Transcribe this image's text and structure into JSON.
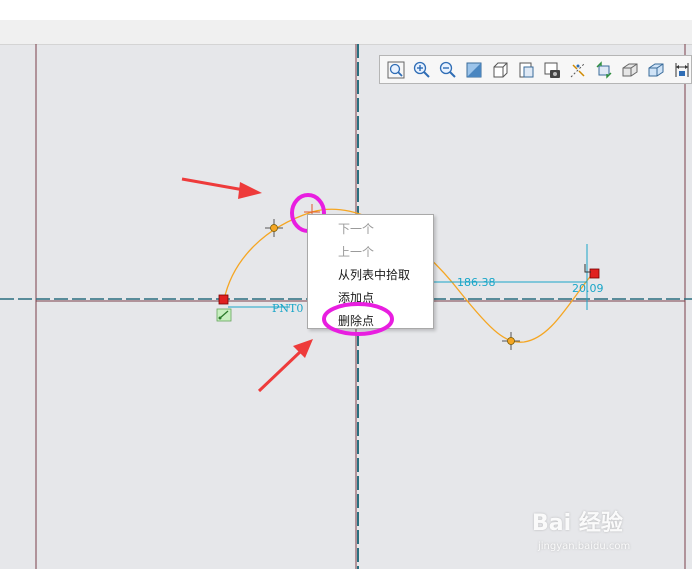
{
  "toolbar": {
    "buttons": [
      {
        "icon": "zoom-fit-icon"
      },
      {
        "icon": "zoom-in-icon"
      },
      {
        "icon": "zoom-out-icon"
      },
      {
        "icon": "shade-mode-icon"
      },
      {
        "icon": "view-orientation-icon"
      },
      {
        "icon": "view-manager-icon"
      },
      {
        "icon": "snapshot-icon"
      },
      {
        "icon": "datum-display-icon"
      },
      {
        "icon": "spin-center-icon"
      },
      {
        "icon": "display-style-icon"
      },
      {
        "icon": "saved-views-icon"
      },
      {
        "icon": "annotation-display-icon"
      }
    ]
  },
  "context_menu": {
    "items": [
      {
        "label": "下一个",
        "enabled": false
      },
      {
        "label": "上一个",
        "enabled": false
      },
      {
        "label": "从列表中拾取",
        "enabled": true
      },
      {
        "label": "添加点",
        "enabled": true
      },
      {
        "label": "删除点",
        "enabled": true
      }
    ]
  },
  "sketch": {
    "dimension_1": "186.38",
    "dimension_2": "20.09",
    "point_label": "PNT0"
  },
  "watermark": {
    "brand": "Bai 经验",
    "url": "jingyan.baidu.com"
  },
  "colors": {
    "spline": "#f5a623",
    "dimension": "#1aa6c8",
    "highlight_circle": "#e81ee0",
    "arrow": "#ee3b3b",
    "endpoint": "#e02020"
  }
}
